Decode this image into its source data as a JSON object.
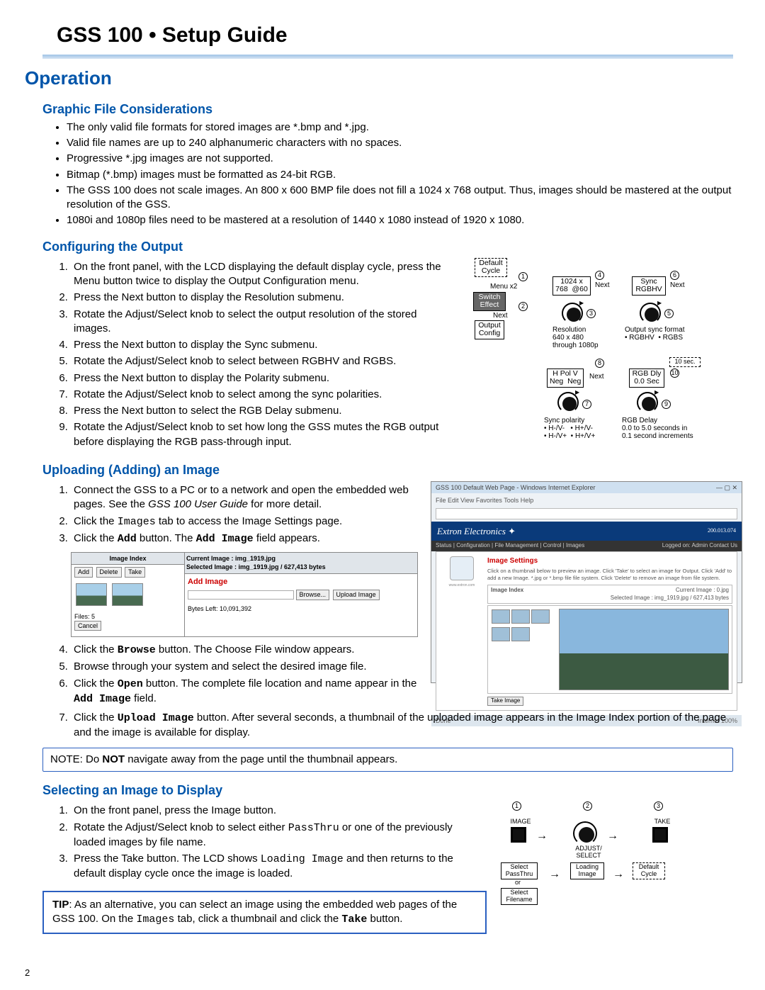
{
  "doc": {
    "title": "GSS 100 • Setup Guide",
    "h1": "Operation",
    "page_number": "2"
  },
  "s1": {
    "heading": "Graphic File Considerations",
    "bullets": [
      "The only valid file formats for stored images are *.bmp and *.jpg.",
      "Valid file names are up to 240 alphanumeric characters with no spaces.",
      "Progressive *.jpg images are not supported.",
      "Bitmap (*.bmp) images must be formatted as 24-bit RGB.",
      "The GSS 100 does not scale images. An 800 x 600 BMP file does not fill a 1024 x 768 output. Thus, images should be mastered at the output resolution of the GSS.",
      "1080i and 1080p files need to be mastered at a resolution of 1440 x 1080 instead of 1920 x 1080."
    ]
  },
  "s2": {
    "heading": "Configuring the Output",
    "steps": [
      "On the front panel, with the LCD displaying the default display cycle, press the Menu button twice to display the Output Configuration menu.",
      "Press the Next button to display the Resolution submenu.",
      "Rotate the Adjust/Select knob to select the output resolution of the stored images.",
      "Press the Next button to display the Sync submenu.",
      "Rotate the Adjust/Select knob to select between RGBHV and RGBS.",
      "Press the Next button to display the Polarity submenu.",
      "Rotate the Adjust/Select knob to select among the sync polarities.",
      "Press the Next button to select the RGB Delay submenu.",
      "Rotate the Adjust/Select knob to set how long the GSS mutes the RGB output before displaying the RGB pass-through input."
    ],
    "diagram": {
      "default_cycle": "Default\nCycle",
      "menu_x2": "Menu x2",
      "switch_effect": "Switch\nEffect",
      "next": "Next",
      "output_config": "Output\nConfig",
      "res_box": "1024 x\n768  @60",
      "res_label": "Resolution\n640 x 480\nthrough 1080p",
      "sync_box": "Sync\nRGBHV",
      "sync_label": "Output sync format\n• RGBHV  • RGBS",
      "hpol_box": "H Pol V\nNeg  Neg",
      "pol_label": "Sync polarity\n• H-/V-   • H+/V-\n• H-/V+  • H+/V+",
      "rgbdly_box": "RGB Dly\n0.0 Sec",
      "rgbdly_label": "RGB Delay\n0.0 to 5.0 seconds in\n0.1 second increments",
      "ten_sec": "10 sec."
    }
  },
  "s3": {
    "heading": "Uploading (Adding) an Image",
    "step1_a": "Connect the GSS to a PC or to a network and open the embedded web pages. See the ",
    "step1_i": "GSS 100 User Guide",
    "step1_b": " for more detail.",
    "step2_a": "Click the ",
    "step2_m": "Images",
    "step2_b": " tab to access the Image Settings page.",
    "step3_a": "Click the ",
    "step3_m1": "Add",
    "step3_b": " button. The ",
    "step3_m2": "Add Image",
    "step3_c": " field appears.",
    "mini": {
      "col_left": "Image Index",
      "col_right_a": "Current Image : img_1919.jpg",
      "col_right_b": "Selected Image : img_1919.jpg / 627,413 bytes",
      "btn_add": "Add",
      "btn_del": "Delete",
      "btn_take": "Take",
      "add_image": "Add Image",
      "browse": "Browse...",
      "upload": "Upload Image",
      "files": "Files:   5",
      "bytes_left": "Bytes Left: 10,091,392",
      "cancel": "Cancel"
    },
    "step4_a": "Click the ",
    "step4_m": "Browse",
    "step4_b": " button. The Choose File window appears.",
    "step5": "Browse through your system and select the desired image file.",
    "step6_a": "Click the ",
    "step6_m": "Open",
    "step6_b": " button. The complete file location and name appear in the ",
    "step6_m2": "Add Image",
    "step6_c": " field.",
    "step7_a": "Click the ",
    "step7_m": "Upload Image",
    "step7_b": " button. After several seconds, a thumbnail of the uploaded image appears in the Image Index portion of the page and the image is available for display.",
    "note_a": "NOTE:",
    "note_b": "  Do ",
    "note_c": "NOT",
    "note_d": " navigate away from the page until the thumbnail appears.",
    "ss": {
      "titlebar": "GSS 100 Default Web Page - Windows Internet Explorer",
      "menus": "File   Edit   View   Favorites   Tools   Help",
      "brand": "Extron Electronics",
      "ip": "200.013.074",
      "tabs": "Status | Configuration | File Management | Control | Images",
      "logged": "Logged on: Admin    Contact Us",
      "panel_heading": "Image Settings",
      "panel_text": "Click on a thumbnail below to preview an image. Click 'Take' to select an image for Output. Click 'Add' to add a new Image. *.jpg or *.bmp file file system. Click 'Delete' to remove an image from file system.",
      "sub_left": "Image Index",
      "sub_right": "Current Image : 0.jpg\nSelected Image : img_1919.jpg / 627,413 bytes",
      "btn_take": "Take Image",
      "footer_l": "Done",
      "footer_r": "Internet        100%"
    }
  },
  "s4": {
    "heading": "Selecting an Image to Display",
    "step1": "On the front panel, press the Image button.",
    "step2_a": "Rotate the Adjust/Select knob to select either ",
    "step2_m": "PassThru",
    "step2_b": " or one of the previously loaded images by file name.",
    "step3_a": "Press the Take button. The LCD shows ",
    "step3_m": "Loading Image",
    "step3_b": " and then returns to the default display cycle once the image is loaded.",
    "tip_a": "TIP",
    "tip_b": ":   As an alternative, you can select an image using the embedded web pages of the GSS 100. On the ",
    "tip_m1": "Images",
    "tip_c": " tab, click a thumbnail and click the ",
    "tip_m2": "Take",
    "tip_d": " button.",
    "d2": {
      "image": "IMAGE",
      "adjust": "ADJUST/\nSELECT",
      "take": "TAKE",
      "sel_pass": "Select\nPassThru",
      "or": "or",
      "sel_file": "Select\nFilename",
      "loading": "Loading\nImage",
      "default": "Default\nCycle"
    }
  }
}
